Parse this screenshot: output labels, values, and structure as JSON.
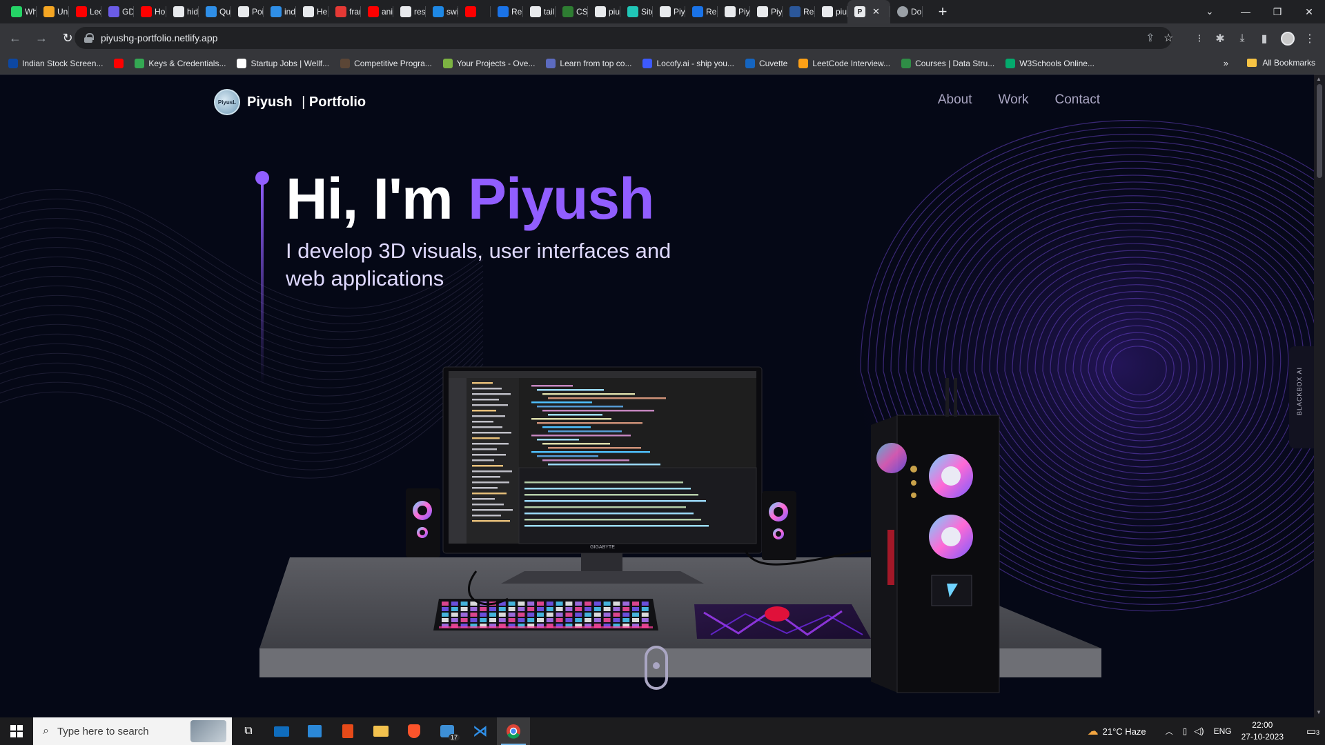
{
  "browser": {
    "tabs": [
      {
        "label": "Wh",
        "icon": "whatsapp-icon",
        "color": "#25d366"
      },
      {
        "label": "Uni",
        "icon": "unstop-icon",
        "color": "#f5a623"
      },
      {
        "label": "Lec",
        "icon": "youtube-icon",
        "color": "#ff0000"
      },
      {
        "label": "GD",
        "icon": "gdsc-icon",
        "color": "#6b5ce7"
      },
      {
        "label": "Ho",
        "icon": "youtube-icon",
        "color": "#ff0000"
      },
      {
        "label": "hid",
        "icon": "github-icon",
        "color": "#e8eaed"
      },
      {
        "label": "Qu",
        "icon": "vscode-icon",
        "color": "#2f8fe8"
      },
      {
        "label": "Poi",
        "icon": "poi-icon",
        "color": "#e8eaed"
      },
      {
        "label": "ind",
        "icon": "vscode-icon",
        "color": "#2f8fe8"
      },
      {
        "label": "Her",
        "icon": "hero-icon",
        "color": "#e8eaed"
      },
      {
        "label": "fran",
        "icon": "red-icon",
        "color": "#e53935"
      },
      {
        "label": "ani",
        "icon": "youtube-icon",
        "color": "#ff0000"
      },
      {
        "label": "res",
        "icon": "github-icon",
        "color": "#e8eaed"
      },
      {
        "label": "swi",
        "icon": "swiper-icon",
        "color": "#1e88e5"
      },
      {
        "label": "",
        "icon": "youtube-icon",
        "color": "#ff0000"
      },
      {
        "label": "Ren",
        "icon": "render-icon",
        "color": "#1a73e8"
      },
      {
        "label": "tail",
        "icon": "github-icon",
        "color": "#e8eaed"
      },
      {
        "label": "CSS",
        "icon": "css-icon",
        "color": "#2e7d32"
      },
      {
        "label": "piu",
        "icon": "github-icon",
        "color": "#e8eaed"
      },
      {
        "label": "Site",
        "icon": "netlify-icon",
        "color": "#20c6b7"
      },
      {
        "label": "Piy",
        "icon": "portfolio-icon",
        "color": "#e8eaed"
      },
      {
        "label": "Ren",
        "icon": "render-icon",
        "color": "#1a73e8"
      },
      {
        "label": "Piy",
        "icon": "portfolio-icon",
        "color": "#e8eaed"
      },
      {
        "label": "Piy",
        "icon": "globe-icon",
        "color": "#e8eaed"
      },
      {
        "label": "Res",
        "icon": "word-icon",
        "color": "#2b579a"
      },
      {
        "label": "piu",
        "icon": "github-icon",
        "color": "#e8eaed"
      }
    ],
    "active_tab": {
      "label": "",
      "icon": "portfolio-icon",
      "close": "✕"
    },
    "extra_tab": {
      "label": "Do",
      "icon": "globe-icon"
    },
    "new_tab": "+",
    "url": "piyushg-portfolio.netlify.app",
    "bookmarks": [
      {
        "label": "Indian Stock Screen...",
        "icon": "stock-icon",
        "color": "#0d47a1"
      },
      {
        "label": "",
        "icon": "youtube-icon",
        "color": "#ff0000"
      },
      {
        "label": "Keys & Credentials...",
        "icon": "map-pin-icon",
        "color": "#34a853"
      },
      {
        "label": "Startup Jobs | Wellf...",
        "icon": "wellfound-icon",
        "color": "#ffffff"
      },
      {
        "label": "Competitive Progra...",
        "icon": "cc-icon",
        "color": "#5b4636"
      },
      {
        "label": "Your Projects - Ove...",
        "icon": "project-icon",
        "color": "#7cb342"
      },
      {
        "label": "Learn from top co...",
        "icon": "learn-icon",
        "color": "#5c6bc0"
      },
      {
        "label": "Locofy.ai - ship you...",
        "icon": "locofy-icon",
        "color": "#3d5afe"
      },
      {
        "label": "Cuvette",
        "icon": "cuvette-icon",
        "color": "#1565c0"
      },
      {
        "label": "LeetCode Interview...",
        "icon": "leetcode-icon",
        "color": "#ffa116"
      },
      {
        "label": "Courses | Data Stru...",
        "icon": "gfg-icon",
        "color": "#2f8d46"
      },
      {
        "label": "W3Schools Online...",
        "icon": "w3schools-icon",
        "color": "#04aa6d"
      }
    ],
    "bookmarks_overflow": "»",
    "all_bookmarks": "All Bookmarks"
  },
  "page": {
    "brand_name": "Piyush",
    "brand_sep": "|",
    "brand_sub": "Portfolio",
    "logo_text": "PiyusL",
    "nav": [
      "About",
      "Work",
      "Contact"
    ],
    "hero_prefix": "Hi, I'm ",
    "hero_name": "Piyush",
    "hero_subtitle": "I develop 3D visuals, user interfaces and web applications",
    "monitor_brand": "GIGABYTE",
    "blackbox_label": "BLACKBOX AI",
    "colors": {
      "accent": "#915eff",
      "bg": "#050816",
      "nav_text": "#aaa6c3"
    }
  },
  "taskbar": {
    "search_placeholder": "Type here to search",
    "weather": "21°C  Haze",
    "language": "ENG",
    "time": "22:00",
    "date": "27-10-2023",
    "notifications": "3",
    "badge": "17"
  }
}
